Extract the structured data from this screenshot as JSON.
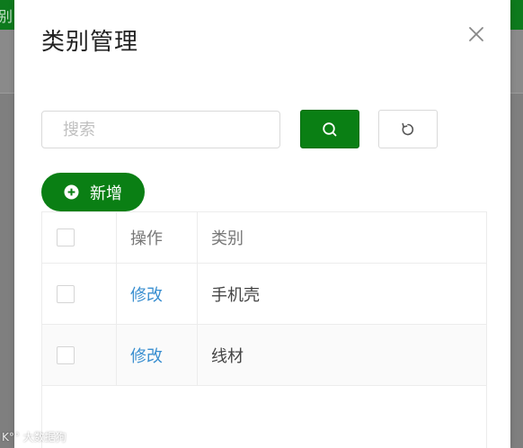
{
  "background": {
    "topbar_text": "别",
    "topbar_color": "#0d7a1d"
  },
  "modal": {
    "title": "类别管理",
    "close_icon": "close-icon"
  },
  "search": {
    "placeholder": "搜索",
    "value": "",
    "search_icon": "search-icon",
    "reset_icon": "refresh-icon"
  },
  "add_button": {
    "label": "新增",
    "icon": "plus-circle-icon",
    "color": "#0a7f14"
  },
  "table": {
    "columns": [
      "",
      "操作",
      "类别"
    ],
    "rows": [
      {
        "action": "修改",
        "category": "手机壳"
      },
      {
        "action": "修改",
        "category": "线材"
      }
    ]
  },
  "watermark": "K°° 大数据狗"
}
